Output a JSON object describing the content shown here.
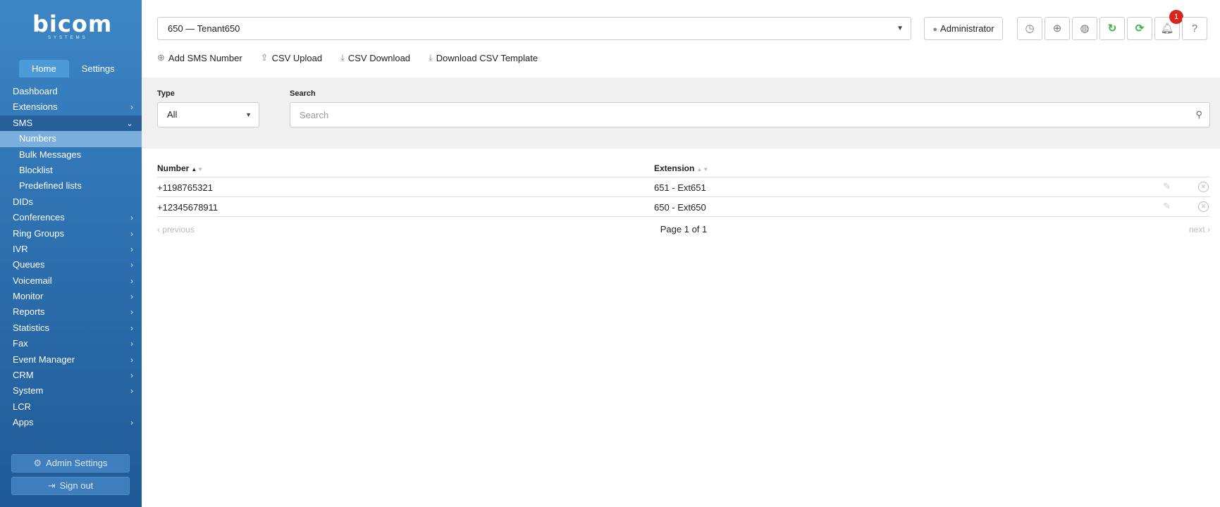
{
  "brand": {
    "logo_text": "bicom",
    "logo_sub": "SYSTEMS"
  },
  "sidebar": {
    "tabs": [
      {
        "label": "Home",
        "active": true
      },
      {
        "label": "Settings",
        "active": false
      }
    ],
    "items": [
      {
        "label": "Dashboard",
        "chevron": ""
      },
      {
        "label": "Extensions",
        "chevron": "›"
      },
      {
        "label": "SMS",
        "chevron": "⌄",
        "open": true
      },
      {
        "label": "Numbers",
        "sub": true,
        "active": true
      },
      {
        "label": "Bulk Messages",
        "sub": true
      },
      {
        "label": "Blocklist",
        "sub": true
      },
      {
        "label": "Predefined lists",
        "sub": true
      },
      {
        "label": "DIDs",
        "chevron": ""
      },
      {
        "label": "Conferences",
        "chevron": "›"
      },
      {
        "label": "Ring Groups",
        "chevron": "›"
      },
      {
        "label": "IVR",
        "chevron": "›"
      },
      {
        "label": "Queues",
        "chevron": "›"
      },
      {
        "label": "Voicemail",
        "chevron": "›"
      },
      {
        "label": "Monitor",
        "chevron": "›"
      },
      {
        "label": "Reports",
        "chevron": "›"
      },
      {
        "label": "Statistics",
        "chevron": "›"
      },
      {
        "label": "Fax",
        "chevron": "›"
      },
      {
        "label": "Event Manager",
        "chevron": "›"
      },
      {
        "label": "CRM",
        "chevron": "›"
      },
      {
        "label": "System",
        "chevron": "›"
      },
      {
        "label": "LCR",
        "chevron": ""
      },
      {
        "label": "Apps",
        "chevron": "›"
      }
    ],
    "admin_settings_label": "Admin Settings",
    "sign_out_label": "Sign out"
  },
  "header": {
    "tenant": "650  —  Tenant650",
    "user": "Administrator",
    "notification_count": "1",
    "icons": [
      "clock-icon",
      "lifebuoy-icon",
      "globe-icon",
      "refresh-icon",
      "sync-icon",
      "bell-icon",
      "help-icon"
    ]
  },
  "toolbar": {
    "add": "Add SMS Number",
    "upload": "CSV Upload",
    "download": "CSV Download",
    "template": "Download CSV Template"
  },
  "filters": {
    "type_label": "Type",
    "type_value": "All",
    "search_label": "Search",
    "search_placeholder": "Search"
  },
  "table": {
    "columns": [
      "Number",
      "Extension"
    ],
    "rows": [
      {
        "number": "+1198765321",
        "extension": "651 - Ext651"
      },
      {
        "number": "+12345678911",
        "extension": "650 - Ext650"
      }
    ],
    "pager": {
      "prev": "previous",
      "status": "Page 1 of 1",
      "next": "next"
    }
  }
}
